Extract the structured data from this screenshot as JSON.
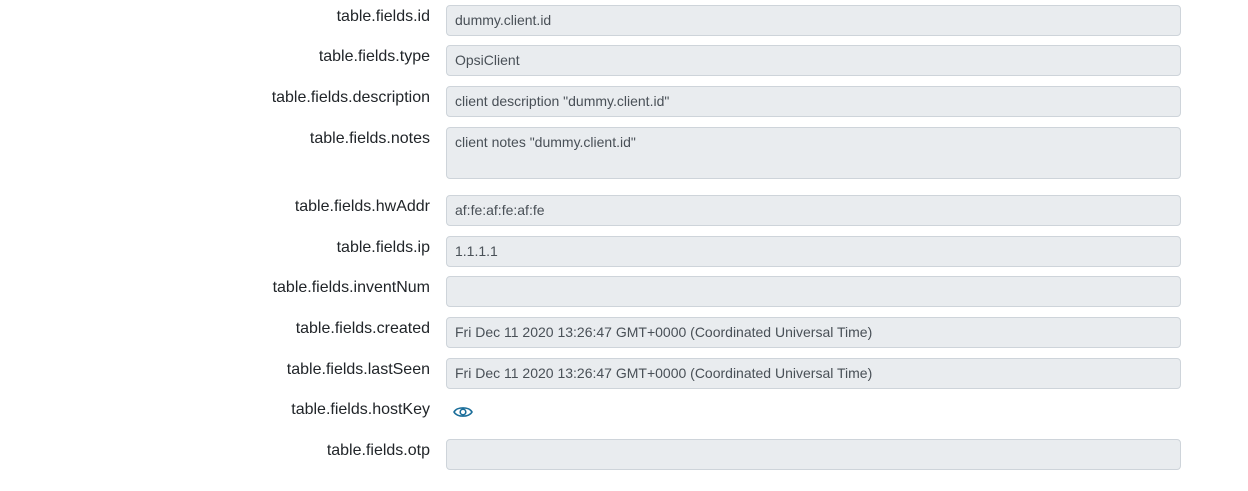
{
  "fields": [
    {
      "key": "id",
      "label": "table.fields.id",
      "value": "dummy.client.id"
    },
    {
      "key": "type",
      "label": "table.fields.type",
      "value": "OpsiClient"
    },
    {
      "key": "description",
      "label": "table.fields.description",
      "value": "client description \"dummy.client.id\""
    },
    {
      "key": "notes",
      "label": "table.fields.notes",
      "value": "client notes \"dummy.client.id\""
    },
    {
      "key": "hwAddr",
      "label": "table.fields.hwAddr",
      "value": "af:fe:af:fe:af:fe"
    },
    {
      "key": "ip",
      "label": "table.fields.ip",
      "value": "1.1.1.1"
    },
    {
      "key": "inventNum",
      "label": "table.fields.inventNum",
      "value": ""
    },
    {
      "key": "created",
      "label": "table.fields.created",
      "value": "Fri Dec 11 2020 13:26:47 GMT+0000 (Coordinated Universal Time)"
    },
    {
      "key": "lastSeen",
      "label": "table.fields.lastSeen",
      "value": "Fri Dec 11 2020 13:26:47 GMT+0000 (Coordinated Universal Time)"
    },
    {
      "key": "hostKey",
      "label": "table.fields.hostKey",
      "icon": "eye-icon"
    },
    {
      "key": "otp",
      "label": "table.fields.otp",
      "value": ""
    }
  ],
  "colors": {
    "field_bg": "#e9ecef",
    "field_border": "#ced4da",
    "icon": "#1b6e9a"
  }
}
